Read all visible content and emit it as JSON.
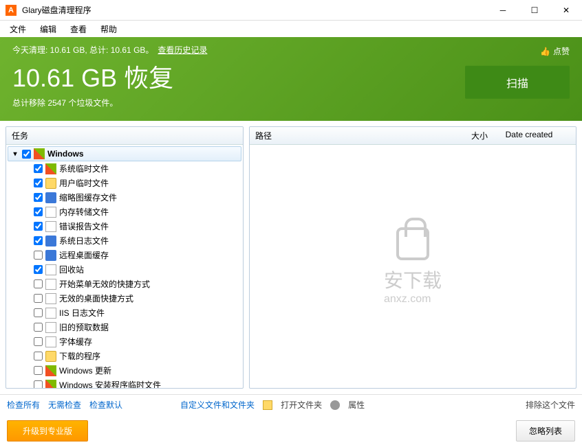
{
  "title": "Glary磁盘清理程序",
  "menu": {
    "file": "文件",
    "edit": "编辑",
    "view": "查看",
    "help": "帮助"
  },
  "hero": {
    "cleaned_label": "今天清理: 10.61 GB, 总计: 10.61 GB。",
    "history_link": "查看历史记录",
    "big_text": "10.61 GB 恢复",
    "sub_text": "总计移除 2547 个垃圾文件。",
    "like": "点赞",
    "scan": "扫描"
  },
  "left_header": "任务",
  "right_headers": {
    "path": "路径",
    "size": "大小",
    "date": "Date created"
  },
  "group": "Windows",
  "tree": [
    {
      "label": "系统临时文件",
      "checked": true,
      "icon": "win"
    },
    {
      "label": "用户临时文件",
      "checked": true,
      "icon": "folder"
    },
    {
      "label": "缩略图缓存文件",
      "checked": true,
      "icon": "blue"
    },
    {
      "label": "内存转储文件",
      "checked": true,
      "icon": "file"
    },
    {
      "label": "错误报告文件",
      "checked": true,
      "icon": "file"
    },
    {
      "label": "系统日志文件",
      "checked": true,
      "icon": "blue"
    },
    {
      "label": "远程桌面缓存",
      "checked": false,
      "icon": "blue"
    },
    {
      "label": "回收站",
      "checked": true,
      "icon": "file"
    },
    {
      "label": "开始菜单无效的快捷方式",
      "checked": false,
      "icon": "file"
    },
    {
      "label": "无效的桌面快捷方式",
      "checked": false,
      "icon": "file"
    },
    {
      "label": "IIS 日志文件",
      "checked": false,
      "icon": "file"
    },
    {
      "label": "旧的预取数据",
      "checked": false,
      "icon": "file"
    },
    {
      "label": "字体缓存",
      "checked": false,
      "icon": "file"
    },
    {
      "label": "下载的程序",
      "checked": false,
      "icon": "folder"
    },
    {
      "label": "Windows 更新",
      "checked": false,
      "icon": "win"
    },
    {
      "label": "Windows 安装程序临时文件",
      "checked": false,
      "icon": "win"
    }
  ],
  "toolbar": {
    "check_all": "检查所有",
    "check_none": "无需检查",
    "check_default": "检查默认",
    "custom": "自定义文件和文件夹",
    "open_folder": "打开文件夹",
    "properties": "属性",
    "exclude": "排除这个文件"
  },
  "bottom": {
    "upgrade": "升级到专业版",
    "ignore": "忽略列表"
  },
  "watermark": "安下载",
  "watermark_sub": "anxz.com"
}
